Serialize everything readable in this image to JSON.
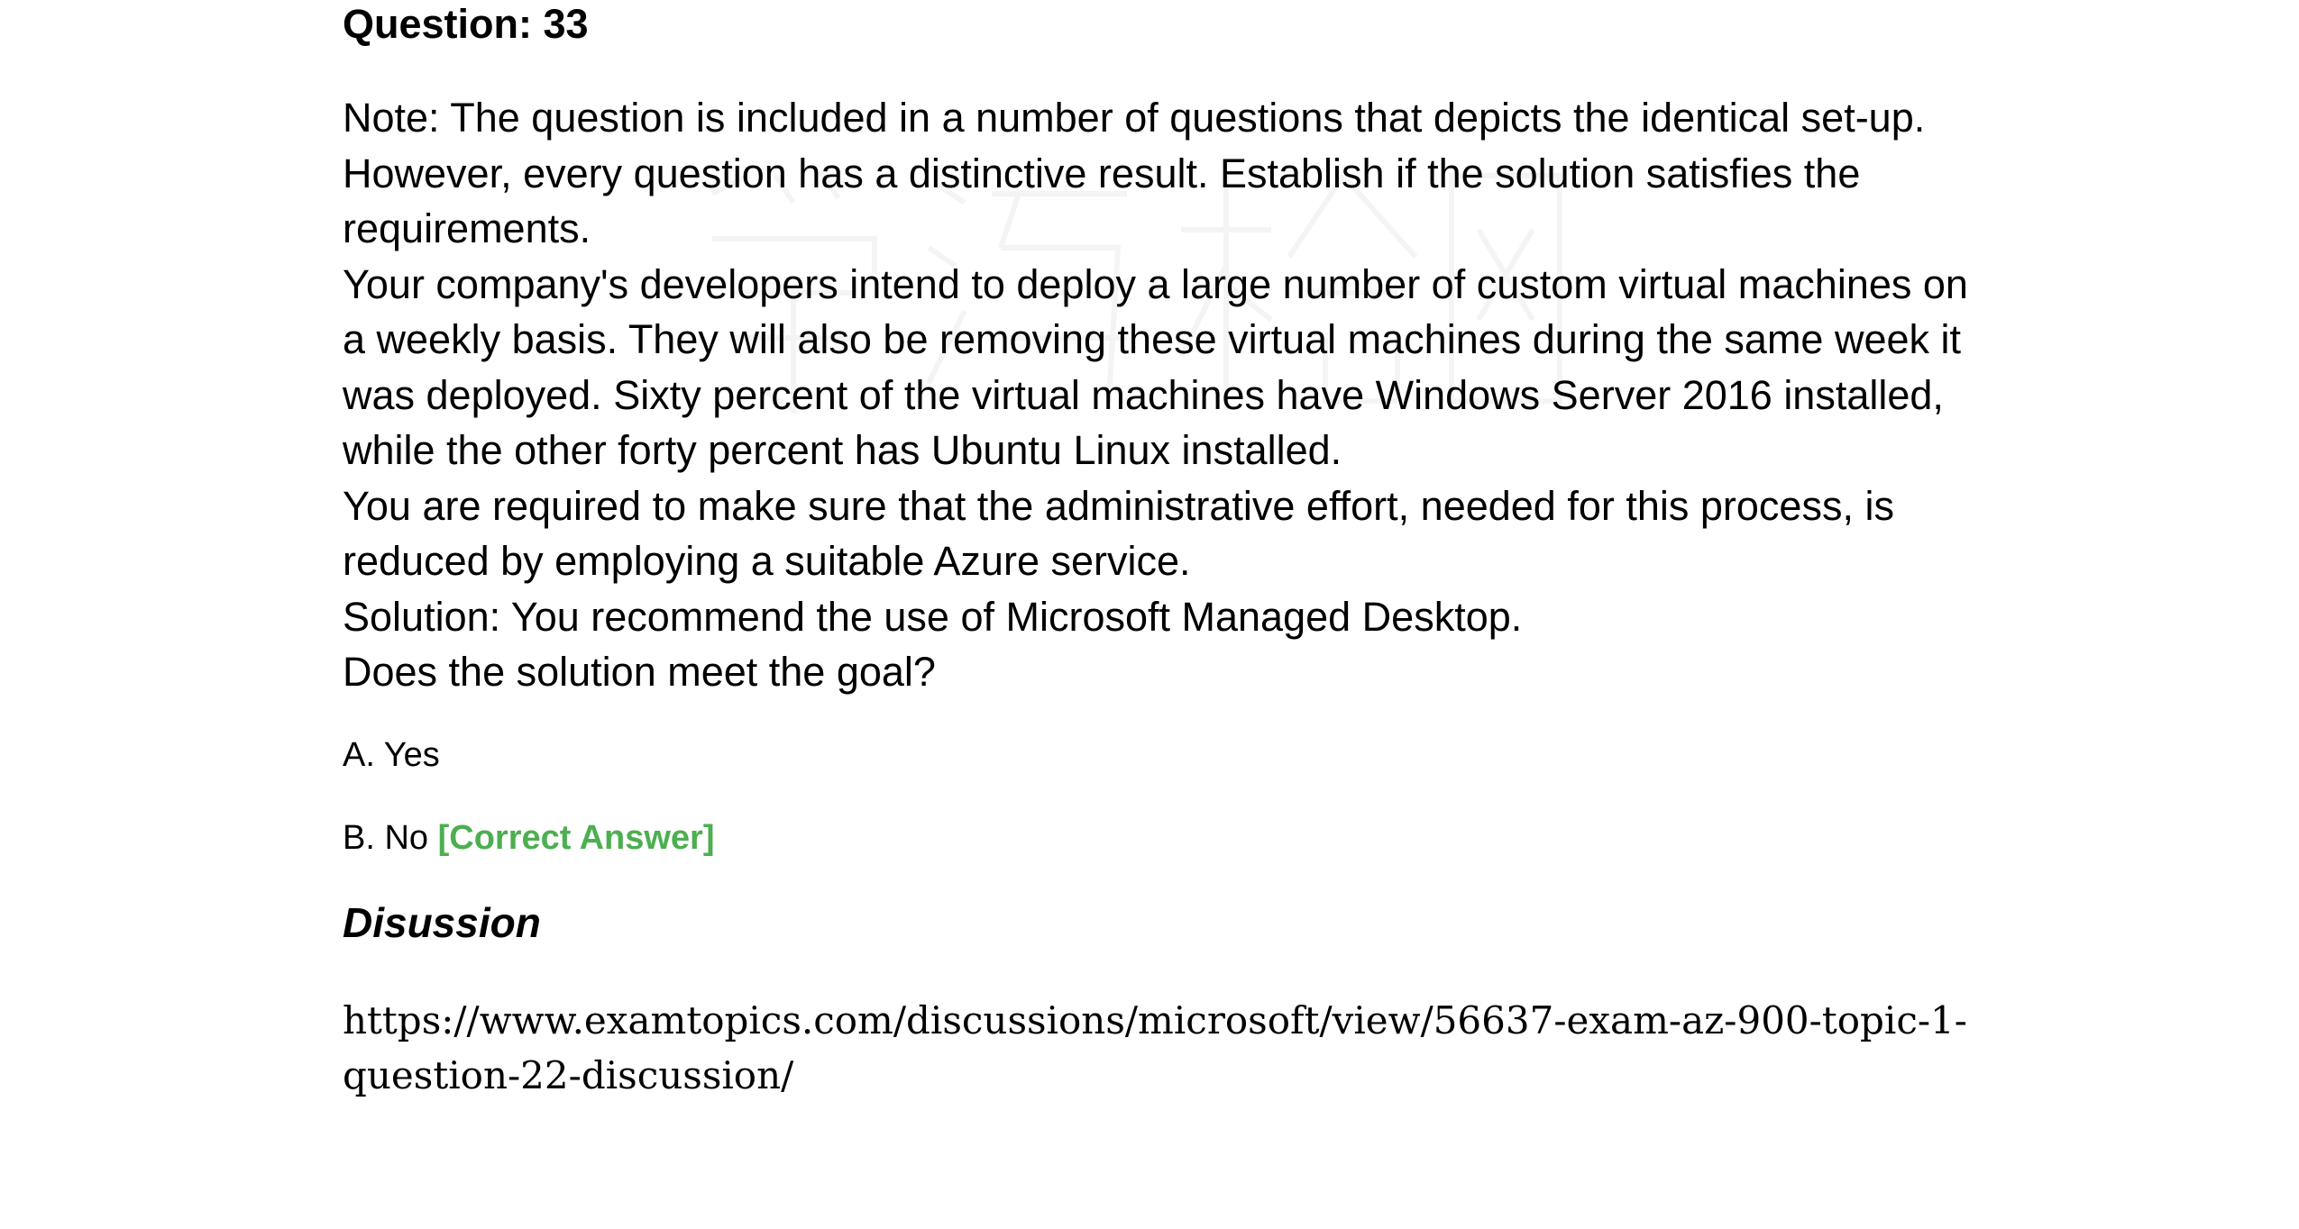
{
  "question": {
    "title": "Question: 33",
    "paragraphs": [
      "Note: The question is included in a number of questions that depicts the identical set-up. However, every question has a distinctive result. Establish if the solution satisfies the requirements.",
      "Your company's developers intend to deploy a large number of custom virtual machines on a weekly basis. They will also be removing these virtual machines during the same week it was deployed. Sixty percent of the virtual machines have Windows Server 2016 installed, while the other forty percent has Ubuntu Linux installed.",
      "You are required to make sure that the administrative effort, needed for this process, is reduced by employing a suitable Azure service.",
      "Solution: You recommend the use of Microsoft Managed Desktop.",
      "Does the solution meet the goal?"
    ]
  },
  "options": [
    {
      "label": "A. Yes",
      "tag": ""
    },
    {
      "label": "B. No",
      "tag": "[Correct Answer]"
    }
  ],
  "discussion": {
    "title": "Disussion",
    "link": "https://www.examtopics.com/discussions/microsoft/view/56637-exam-az-900-topic-1-question-22-discussion/"
  },
  "colors": {
    "correct": "#4caf50",
    "text": "#000000",
    "watermark": "#9e9e9e"
  }
}
